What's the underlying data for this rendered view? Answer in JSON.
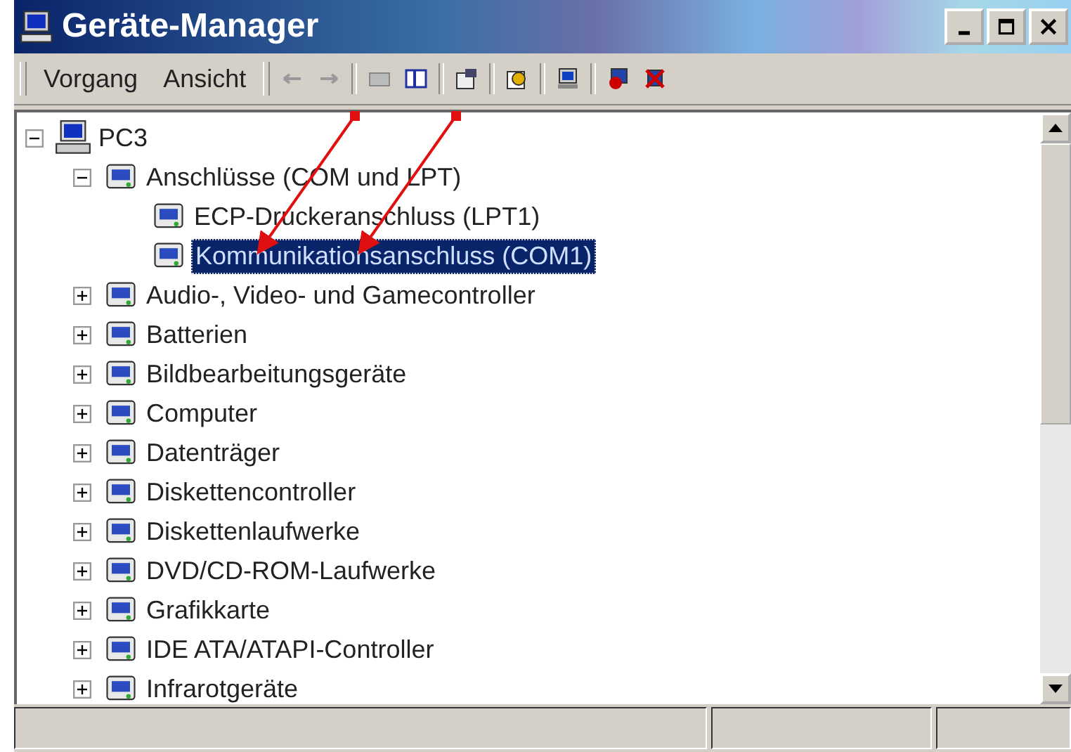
{
  "window": {
    "title": "Geräte-Manager"
  },
  "menu": [
    {
      "label": "Vorgang"
    },
    {
      "label": "Ansicht"
    }
  ],
  "tree": [
    {
      "label": "PC3",
      "expanded": true,
      "selected": false,
      "children": [
        {
          "label": "Anschlüsse (COM und LPT)",
          "expanded": true,
          "selected": false,
          "children": [
            {
              "label": "ECP-Druckeranschluss (LPT1)",
              "selected": false
            },
            {
              "label": "Kommunikationsanschluss (COM1)",
              "selected": true
            }
          ]
        },
        {
          "label": "Audio-, Video- und Gamecontroller",
          "expanded": false,
          "selected": false
        },
        {
          "label": "Batterien",
          "expanded": false,
          "selected": false
        },
        {
          "label": "Bildbearbeitungsgeräte",
          "expanded": false,
          "selected": false
        },
        {
          "label": "Computer",
          "expanded": false,
          "selected": false
        },
        {
          "label": "Datenträger",
          "expanded": false,
          "selected": false
        },
        {
          "label": "Diskettencontroller",
          "expanded": false,
          "selected": false
        },
        {
          "label": "Diskettenlaufwerke",
          "expanded": false,
          "selected": false
        },
        {
          "label": "DVD/CD-ROM-Laufwerke",
          "expanded": false,
          "selected": false
        },
        {
          "label": "Grafikkarte",
          "expanded": false,
          "selected": false
        },
        {
          "label": "IDE ATA/ATAPI-Controller",
          "expanded": false,
          "selected": false
        },
        {
          "label": "Infrarotgeräte",
          "expanded": false,
          "selected": false
        }
      ]
    }
  ]
}
